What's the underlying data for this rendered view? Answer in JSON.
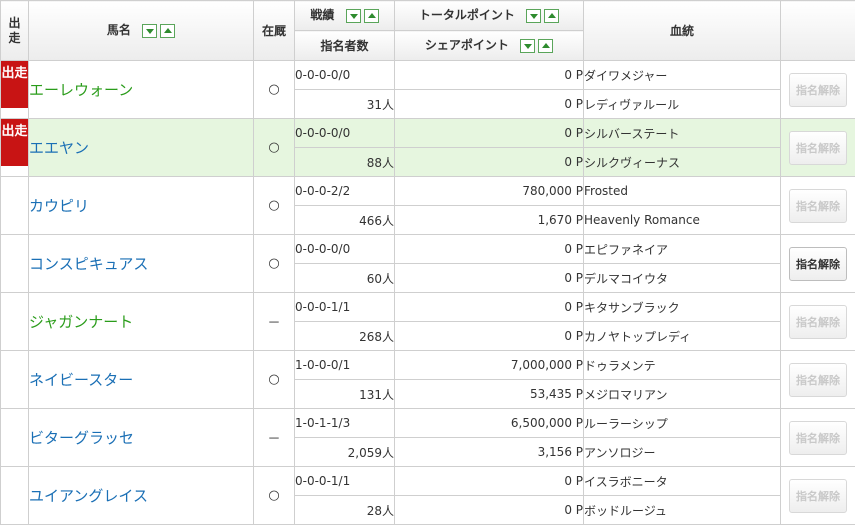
{
  "header": {
    "shusso": "出走",
    "name": "馬名",
    "zaikyu": "在厩",
    "record": "戦績",
    "nominees": "指名者数",
    "total_points": "トータルポイント",
    "share_points": "シェアポイント",
    "bloodline": "血統"
  },
  "horses": [
    {
      "shusso": "出走",
      "name": "エーレウォーン",
      "name_color": "green",
      "zaikyu": "○",
      "record": "0-0-0-0/0",
      "nominees": "31人",
      "total_points": "0 P",
      "share_points": "0 P",
      "sire": "ダイワメジャー",
      "dam": "レディヴァルール",
      "button": "指名解除",
      "button_active": false,
      "highlight": false
    },
    {
      "shusso": "出走",
      "name": "エエヤン",
      "name_color": "blue",
      "zaikyu": "○",
      "record": "0-0-0-0/0",
      "nominees": "88人",
      "total_points": "0 P",
      "share_points": "0 P",
      "sire": "シルバーステート",
      "dam": "シルクヴィーナス",
      "button": "指名解除",
      "button_active": false,
      "highlight": true
    },
    {
      "shusso": "",
      "name": "カウピリ",
      "name_color": "blue",
      "zaikyu": "○",
      "record": "0-0-0-2/2",
      "nominees": "466人",
      "total_points": "780,000 P",
      "share_points": "1,670 P",
      "sire": "Frosted",
      "dam": "Heavenly Romance",
      "button": "指名解除",
      "button_active": false,
      "highlight": false
    },
    {
      "shusso": "",
      "name": "コンスピキュアス",
      "name_color": "blue",
      "zaikyu": "○",
      "record": "0-0-0-0/0",
      "nominees": "60人",
      "total_points": "0 P",
      "share_points": "0 P",
      "sire": "エピファネイア",
      "dam": "デルマコイウタ",
      "button": "指名解除",
      "button_active": true,
      "highlight": false
    },
    {
      "shusso": "",
      "name": "ジャガンナート",
      "name_color": "green",
      "zaikyu": "－",
      "record": "0-0-0-1/1",
      "nominees": "268人",
      "total_points": "0 P",
      "share_points": "0 P",
      "sire": "キタサンブラック",
      "dam": "カノヤトップレディ",
      "button": "指名解除",
      "button_active": false,
      "highlight": false
    },
    {
      "shusso": "",
      "name": "ネイビースター",
      "name_color": "blue",
      "zaikyu": "○",
      "record": "1-0-0-0/1",
      "nominees": "131人",
      "total_points": "7,000,000 P",
      "share_points": "53,435 P",
      "sire": "ドゥラメンテ",
      "dam": "メジロマリアン",
      "button": "指名解除",
      "button_active": false,
      "highlight": false
    },
    {
      "shusso": "",
      "name": "ビターグラッセ",
      "name_color": "blue",
      "zaikyu": "－",
      "record": "1-0-1-1/3",
      "nominees": "2,059人",
      "total_points": "6,500,000 P",
      "share_points": "3,156 P",
      "sire": "ルーラーシップ",
      "dam": "アンソロジー",
      "button": "指名解除",
      "button_active": false,
      "highlight": false
    },
    {
      "shusso": "",
      "name": "ユイアングレイス",
      "name_color": "blue",
      "zaikyu": "○",
      "record": "0-0-0-1/1",
      "nominees": "28人",
      "total_points": "0 P",
      "share_points": "0 P",
      "sire": "イスラボニータ",
      "dam": "ボッドルージュ",
      "button": "指名解除",
      "button_active": false,
      "highlight": false
    }
  ]
}
